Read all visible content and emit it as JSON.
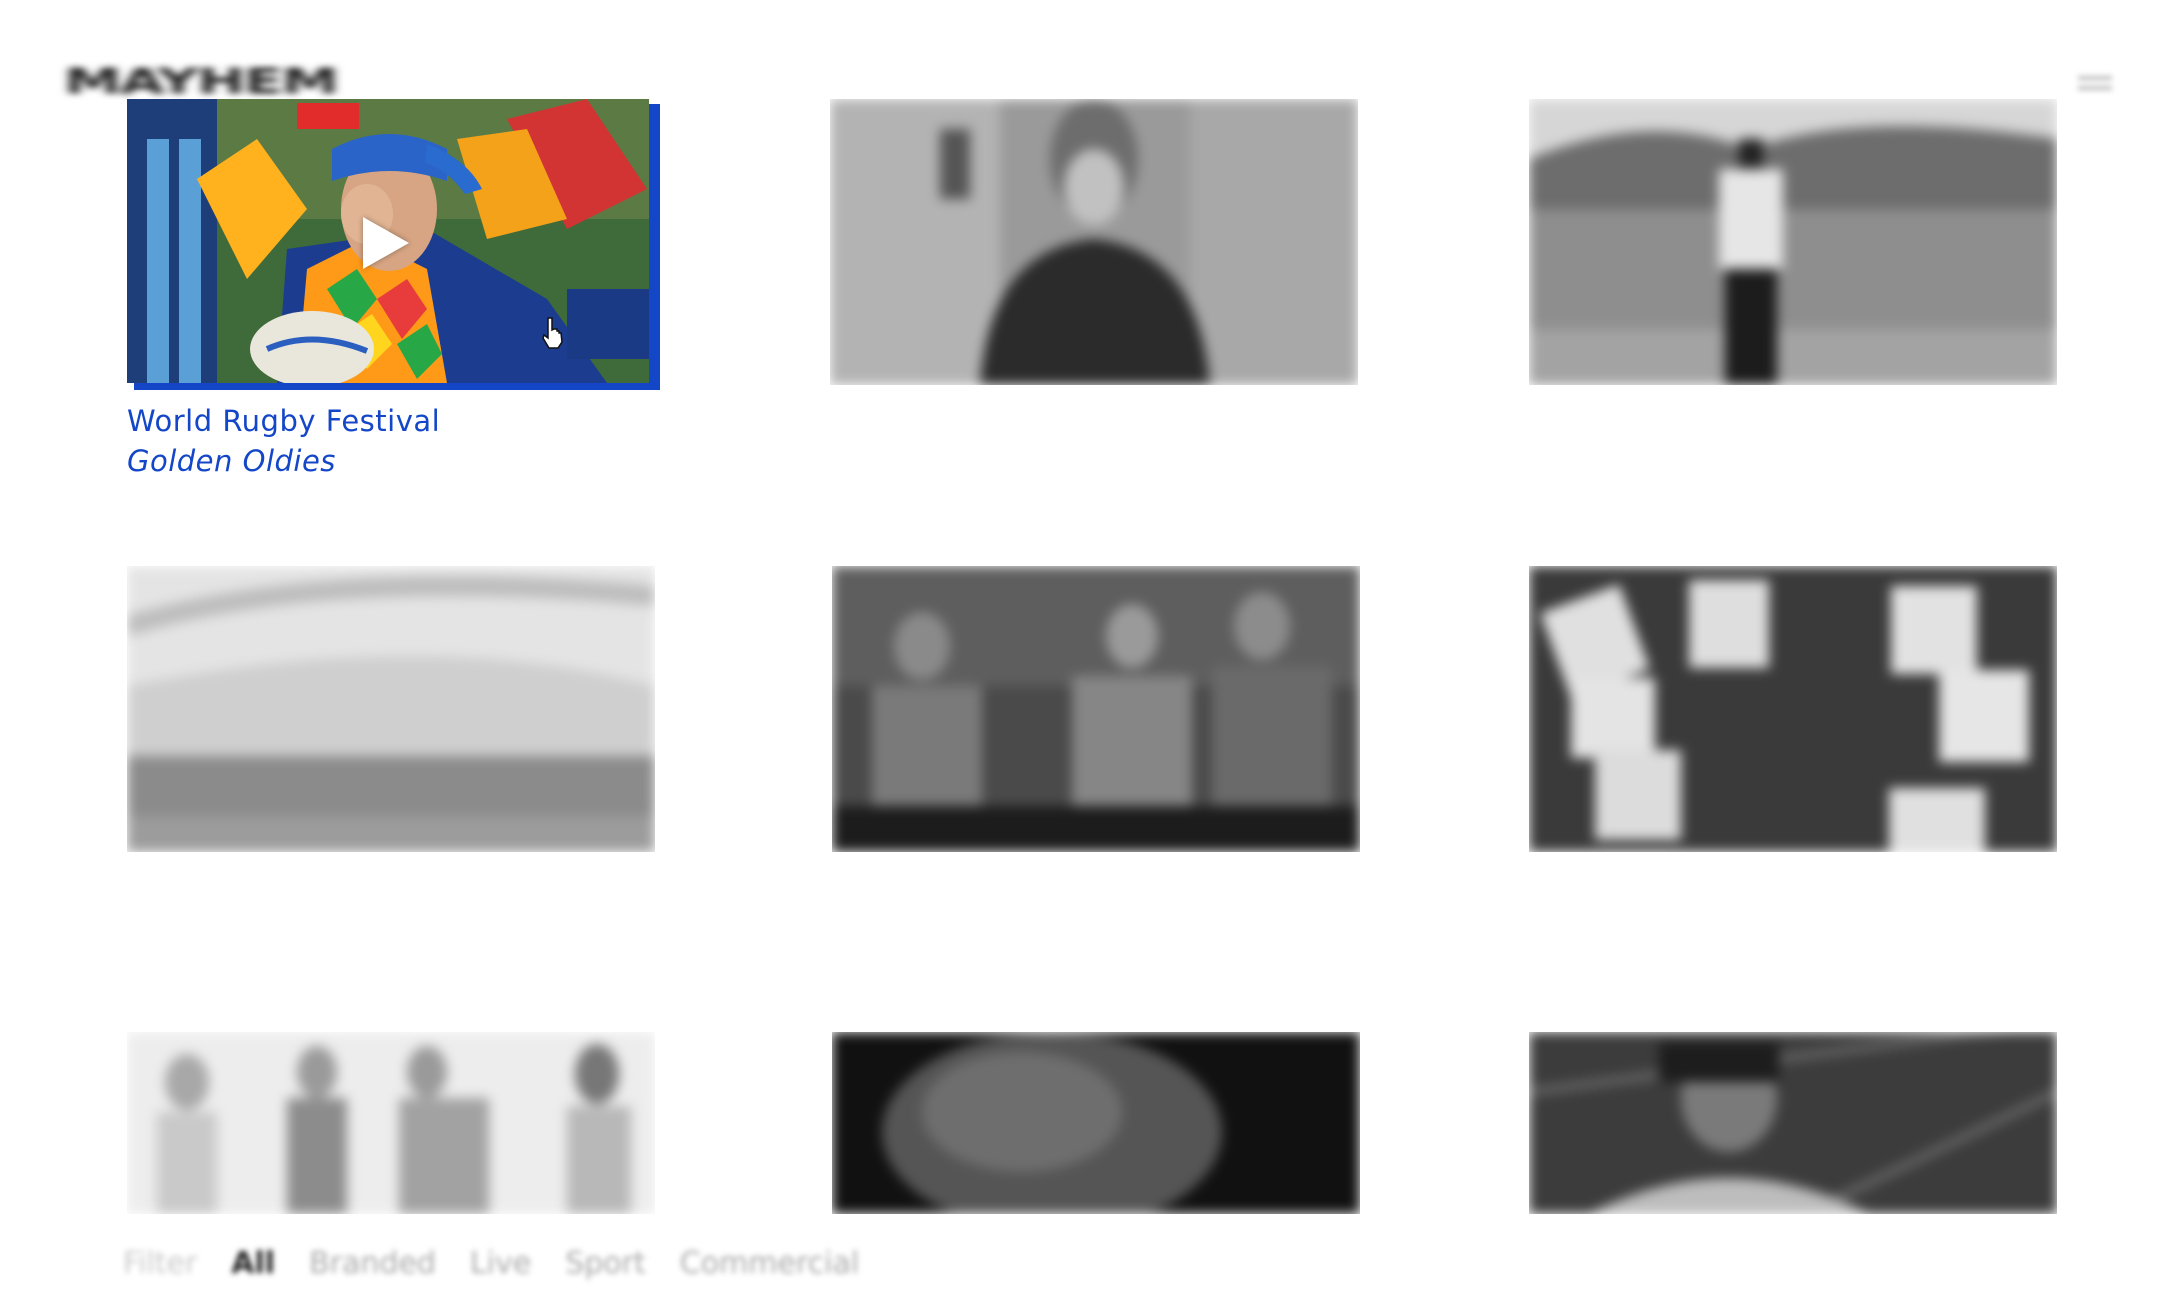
{
  "brand": {
    "logo_text": "MAYHEM"
  },
  "header": {
    "menu_icon": "hamburger-menu-icon"
  },
  "featured": {
    "title": "World Rugby Festival",
    "subtitle": "Golden Oldies",
    "play_icon": "play-icon",
    "accent_color": "#1446c8"
  },
  "filter": {
    "label": "Filter",
    "options": [
      "All",
      "Branded",
      "Live",
      "Sport",
      "Commercial"
    ],
    "selected": "All"
  }
}
